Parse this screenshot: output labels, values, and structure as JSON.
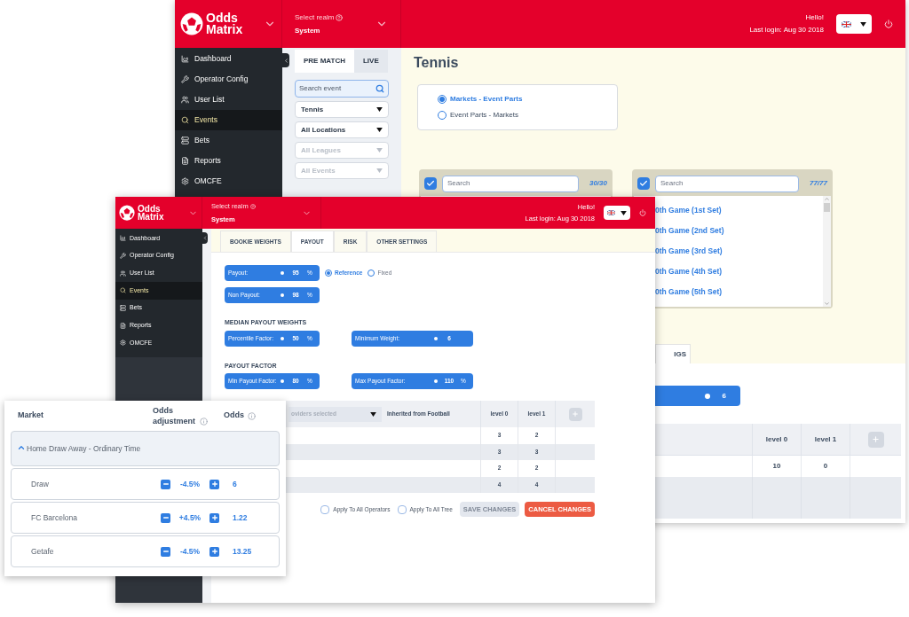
{
  "back_window": {
    "header": {
      "logo": [
        "Odds",
        "Matrix"
      ],
      "realm_label": "Select realm",
      "realm": "System",
      "greeting": "Hello!",
      "last_login": "Last login: Aug 30 2018"
    },
    "sidebar": [
      {
        "label": "Dashboard",
        "selected": false
      },
      {
        "label": "Operator Config",
        "selected": false
      },
      {
        "label": "User List",
        "selected": false
      },
      {
        "label": "Events",
        "selected": true
      },
      {
        "label": "Bets",
        "selected": false
      },
      {
        "label": "Reports",
        "selected": false
      },
      {
        "label": "OMCFE",
        "selected": false
      }
    ],
    "event_tabs": [
      {
        "label": "PRE MATCH",
        "selected": true
      },
      {
        "label": "LIVE",
        "selected": false
      }
    ],
    "search": {
      "placeholder": "Search event"
    },
    "filters": [
      {
        "value": "Tennis",
        "disabled": false
      },
      {
        "value": "All Locations",
        "disabled": false
      },
      {
        "value": "All Leagues",
        "disabled": true
      },
      {
        "value": "All Events",
        "disabled": true
      }
    ],
    "title": "Tennis",
    "view_options": [
      {
        "label": "Markets - Event Parts",
        "selected": true
      },
      {
        "label": "Event Parts - Markets",
        "selected": false
      }
    ],
    "lists": [
      {
        "placeholder": "Search",
        "count": "30/30",
        "checked": true
      },
      {
        "placeholder": "Search",
        "count": "77/77",
        "checked": true,
        "items": [
          "0th Game (1st Set)",
          "0th Game (2nd Set)",
          "0th Game (3rd Set)",
          "0th Game (4th Set)",
          "0th Game (5th Set)"
        ]
      }
    ],
    "tab_fragment": "IGS",
    "weight_value": "6",
    "table": {
      "columns": [
        "level 0",
        "level 1"
      ],
      "rows": [
        [
          "10",
          "0"
        ]
      ]
    }
  },
  "front_window": {
    "header": {
      "logo": [
        "Odds",
        "Matrix"
      ],
      "realm_label": "Select realm",
      "realm": "System",
      "greeting": "Hello!",
      "last_login": "Last login: Aug 30 2018"
    },
    "sidebar": [
      {
        "label": "Dashboard",
        "selected": false
      },
      {
        "label": "Operator Config",
        "selected": false
      },
      {
        "label": "User List",
        "selected": false
      },
      {
        "label": "Events",
        "selected": true
      },
      {
        "label": "Bets",
        "selected": false
      },
      {
        "label": "Reports",
        "selected": false
      },
      {
        "label": "OMCFE",
        "selected": false
      }
    ],
    "tabs": [
      {
        "label": "BOOKIE WEIGHTS",
        "selected": false
      },
      {
        "label": "PAYOUT",
        "selected": true
      },
      {
        "label": "RISK",
        "selected": false
      },
      {
        "label": "OTHER SETTINGS",
        "selected": false
      }
    ],
    "payout_fields": [
      {
        "label": "Payout:",
        "value": "95",
        "unit": "%"
      },
      {
        "label": "Non Payout:",
        "value": "98",
        "unit": "%"
      }
    ],
    "payout_modes": [
      {
        "label": "Reference",
        "selected": true
      },
      {
        "label": "Fixed",
        "selected": false
      }
    ],
    "sections": [
      {
        "title": "MEDIAN PAYOUT WEIGHTS",
        "fields": [
          {
            "label": "Percentile Factor:",
            "value": "50",
            "unit": "%"
          },
          {
            "label": "Minimum Weight:",
            "value": "6"
          }
        ]
      },
      {
        "title": "PAYOUT FACTOR",
        "fields": [
          {
            "label": "Min Payout Factor:",
            "value": "80",
            "unit": "%"
          },
          {
            "label": "Max Payout Factor:",
            "value": "110",
            "unit": "%"
          }
        ]
      }
    ],
    "table": {
      "provider_select": "oviders selected",
      "inherited": "Inherited from Football",
      "columns": [
        "level 0",
        "level 1"
      ],
      "rows": [
        [
          "3",
          "2"
        ],
        [
          "3",
          "3"
        ],
        [
          "2",
          "2"
        ],
        [
          "4",
          "4"
        ]
      ]
    },
    "apply_options": [
      {
        "label": "Apply To All Operators",
        "checked": false
      },
      {
        "label": "Apply To All Tree",
        "checked": false
      }
    ],
    "buttons": [
      {
        "label": "SAVE CHANGES",
        "disabled": true,
        "kind": "save"
      },
      {
        "label": "CANCEL CHANGES",
        "disabled": false,
        "kind": "cancel"
      }
    ]
  },
  "odds_card": {
    "columns": [
      "Market",
      "Odds adjustment",
      "Odds"
    ],
    "group": {
      "label": "Home Draw Away - Ordinary Time",
      "expanded": true
    },
    "rows": [
      {
        "name": "Draw",
        "adjustment": "-4.5%",
        "odds": "6"
      },
      {
        "name": "FC Barcelona",
        "adjustment": "+4.5%",
        "odds": "1.22"
      },
      {
        "name": "Getafe",
        "adjustment": "-4.5%",
        "odds": "13.25"
      }
    ]
  }
}
